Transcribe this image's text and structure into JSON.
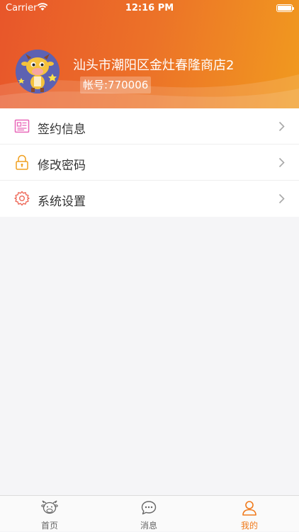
{
  "status_bar": {
    "carrier": "Carrier",
    "time": "12:16 PM"
  },
  "profile": {
    "shop_name": "汕头市潮阳区金灶春隆商店2",
    "account": "帐号:770006"
  },
  "menu": {
    "items": [
      {
        "label": "签约信息",
        "icon": "contract-icon"
      },
      {
        "label": "修改密码",
        "icon": "lock-icon"
      },
      {
        "label": "系统设置",
        "icon": "gear-icon"
      }
    ]
  },
  "tabbar": {
    "tabs": [
      {
        "label": "首页",
        "icon": "cow-home-icon",
        "active": false
      },
      {
        "label": "消息",
        "icon": "chat-bubble-icon",
        "active": false
      },
      {
        "label": "我的",
        "icon": "person-icon",
        "active": true
      }
    ]
  },
  "colors": {
    "accent": "#f07a1c",
    "header_start": "#e8562a",
    "header_end": "#f19a1f"
  }
}
